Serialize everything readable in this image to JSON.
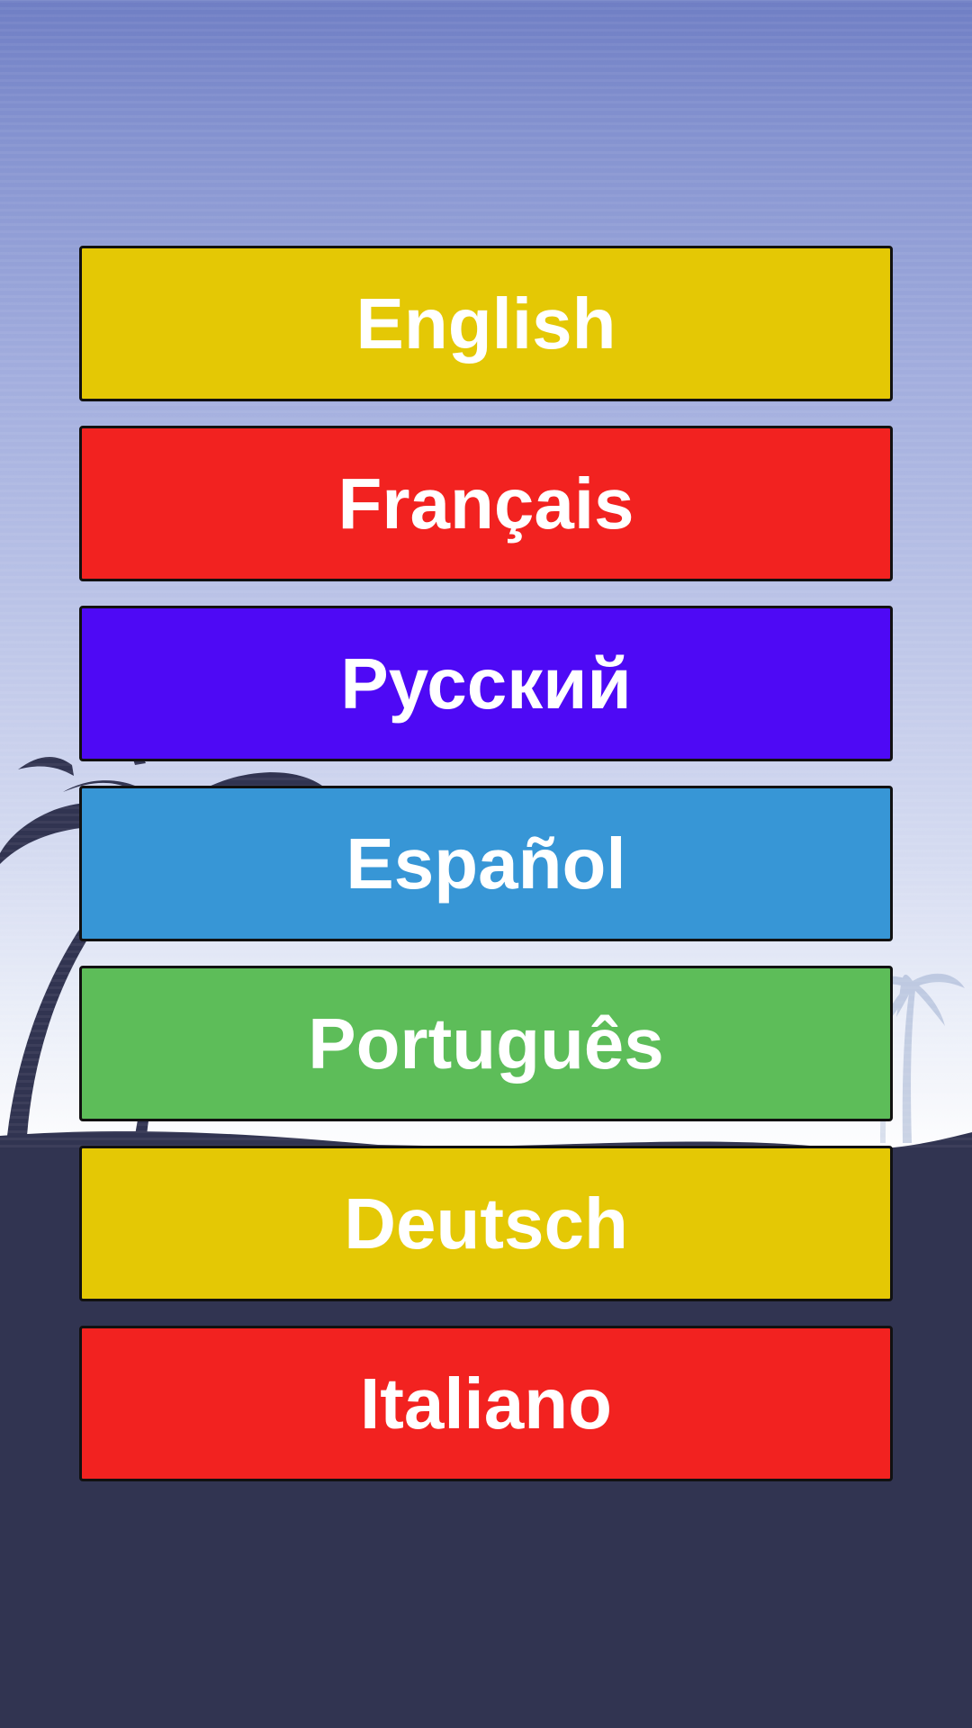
{
  "languages": [
    {
      "label": "English",
      "color": "#e4c805"
    },
    {
      "label": "Français",
      "color": "#f22220"
    },
    {
      "label": "Русский",
      "color": "#4e09f5"
    },
    {
      "label": "Español",
      "color": "#3796d6"
    },
    {
      "label": "Português",
      "color": "#5dbd59"
    },
    {
      "label": "Deutsch",
      "color": "#e4c805"
    },
    {
      "label": "Italiano",
      "color": "#f22220"
    }
  ],
  "background": {
    "sky_top_color": "#6f7ec4",
    "horizon_color": "#ffffff",
    "ground_color": "#313451",
    "silhouette_color": "#313451"
  }
}
